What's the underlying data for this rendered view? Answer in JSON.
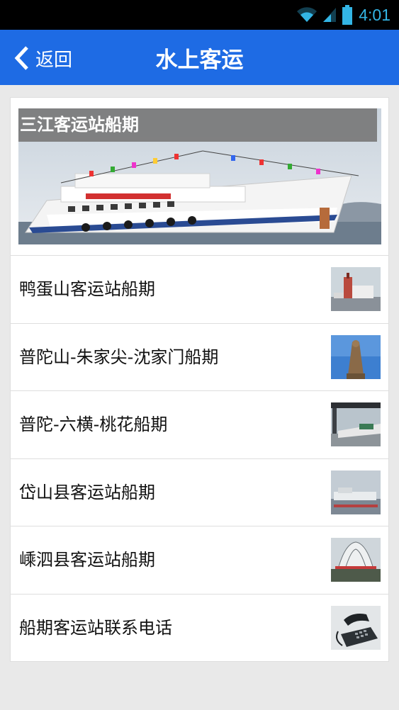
{
  "status_bar": {
    "time": "4:01",
    "icons": [
      "wifi-icon",
      "signal-icon",
      "battery-icon"
    ],
    "accent": "#33b5e5"
  },
  "app_bar": {
    "back_label": "返回",
    "title": "水上客运",
    "color": "#1e6be4"
  },
  "hero": {
    "caption": "三江客运站船期"
  },
  "list": [
    {
      "label": "鸭蛋山客运站船期",
      "thumb": "terminal-photo"
    },
    {
      "label": "普陀山-朱家尖-沈家门船期",
      "thumb": "guanyin-statue-photo"
    },
    {
      "label": "普陀-六横-桃花船期",
      "thumb": "pier-photo"
    },
    {
      "label": "岱山县客运站船期",
      "thumb": "harbor-photo"
    },
    {
      "label": "嵊泗县客运站船期",
      "thumb": "station-building-photo"
    },
    {
      "label": "船期客运站联系电话",
      "thumb": "telephone-photo"
    }
  ]
}
